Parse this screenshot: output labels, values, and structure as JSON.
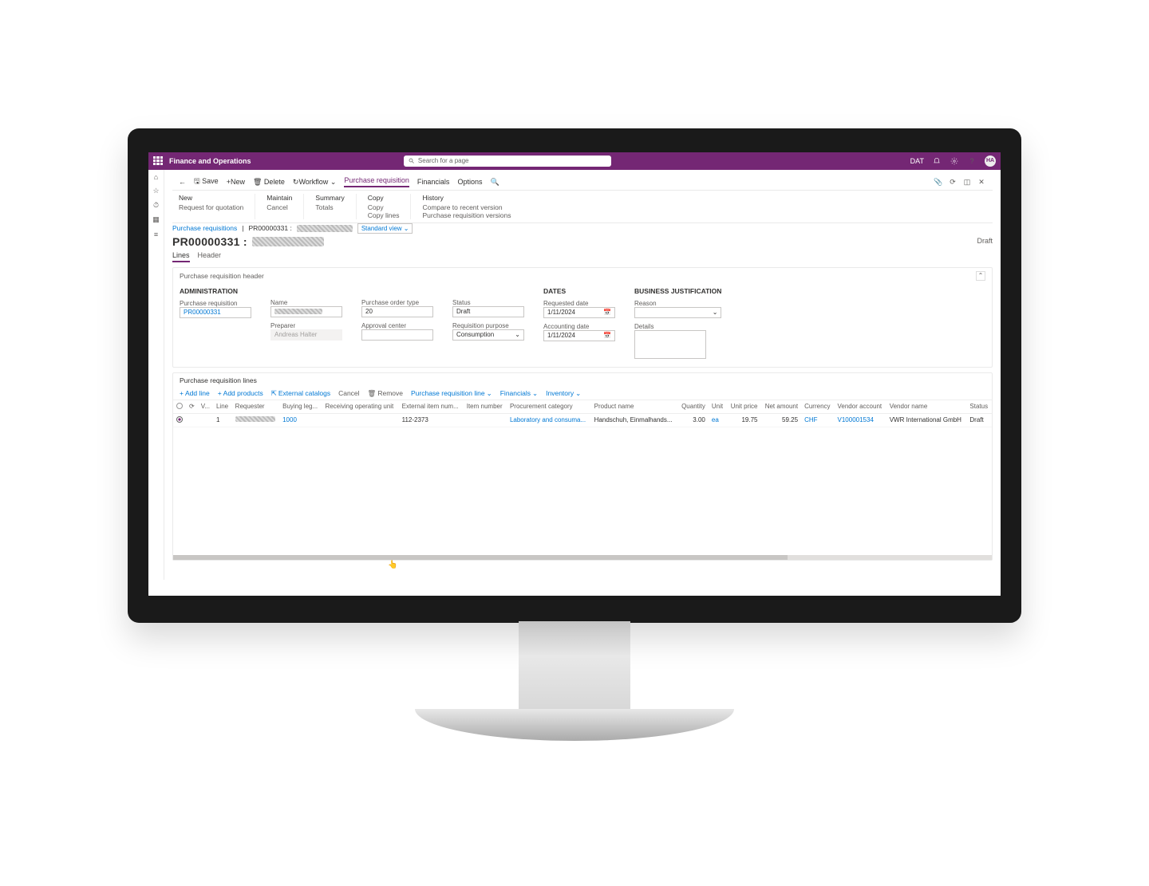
{
  "topbar": {
    "app": "Finance and Operations",
    "search": "Search for a page",
    "company": "DAT",
    "avatar": "HA"
  },
  "cmdbar": {
    "save": "Save",
    "new": "New",
    "delete": "Delete",
    "workflow": "Workflow",
    "pr": "Purchase requisition",
    "financials": "Financials",
    "options": "Options"
  },
  "ribbon": {
    "new": {
      "head": "New",
      "a": "Request for quotation"
    },
    "maintain": {
      "head": "Maintain",
      "a": "Cancel"
    },
    "summary": {
      "head": "Summary",
      "a": "Totals"
    },
    "copy": {
      "head": "Copy",
      "a": "Copy",
      "b": "Copy lines"
    },
    "history": {
      "head": "History",
      "a": "Compare to recent version",
      "b": "Purchase requisition versions"
    }
  },
  "crumb": {
    "root": "Purchase requisitions",
    "id": "PR00000331 :",
    "view": "Standard view"
  },
  "title": "PR00000331 :",
  "status": "Draft",
  "tabs": {
    "lines": "Lines",
    "header": "Header"
  },
  "hdrsection": {
    "title": "Purchase requisition header",
    "admin": {
      "h": "ADMINISTRATION",
      "prlbl": "Purchase requisition",
      "prid": "PR00000331",
      "namelbl": "Name",
      "preplbl": "Preparer",
      "prep": "Andreas Halter",
      "potypelbl": "Purchase order type",
      "potype": "20",
      "approvlbl": "Approval center",
      "statuslbl": "Status",
      "statusval": "Draft",
      "purplbl": "Requisition purpose",
      "purp": "Consumption"
    },
    "dates": {
      "h": "DATES",
      "reqlbl": "Requested date",
      "req": "1/11/2024",
      "acclbl": "Accounting date",
      "acc": "1/11/2024"
    },
    "biz": {
      "h": "BUSINESS JUSTIFICATION",
      "reasonlbl": "Reason",
      "detailslbl": "Details"
    }
  },
  "linessec": {
    "title": "Purchase requisition lines",
    "cmds": {
      "add": "Add line",
      "addp": "Add products",
      "ext": "External catalogs",
      "cancel": "Cancel",
      "remove": "Remove",
      "prl": "Purchase requisition line",
      "fin": "Financials",
      "inv": "Inventory"
    },
    "cols": {
      "line": "Line",
      "requester": "Requester",
      "buying": "Buying leg...",
      "recv": "Receiving operating unit",
      "extitem": "External item num...",
      "item": "Item number",
      "proc": "Procurement category",
      "prod": "Product name",
      "qty": "Quantity",
      "unit": "Unit",
      "uprice": "Unit price",
      "net": "Net amount",
      "curr": "Currency",
      "vacc": "Vendor account",
      "vname": "Vendor name",
      "status": "Status"
    },
    "row": {
      "line": "1",
      "buying": "1000",
      "extitem": "112-2373",
      "proc": "Laboratory and consuma...",
      "prod": "Handschuh, Einmalhands...",
      "qty": "3.00",
      "unit": "ea",
      "uprice": "19.75",
      "net": "59.25",
      "curr": "CHF",
      "vacc": "V100001534",
      "vname": "VWR International GmbH",
      "status": "Draft"
    }
  }
}
